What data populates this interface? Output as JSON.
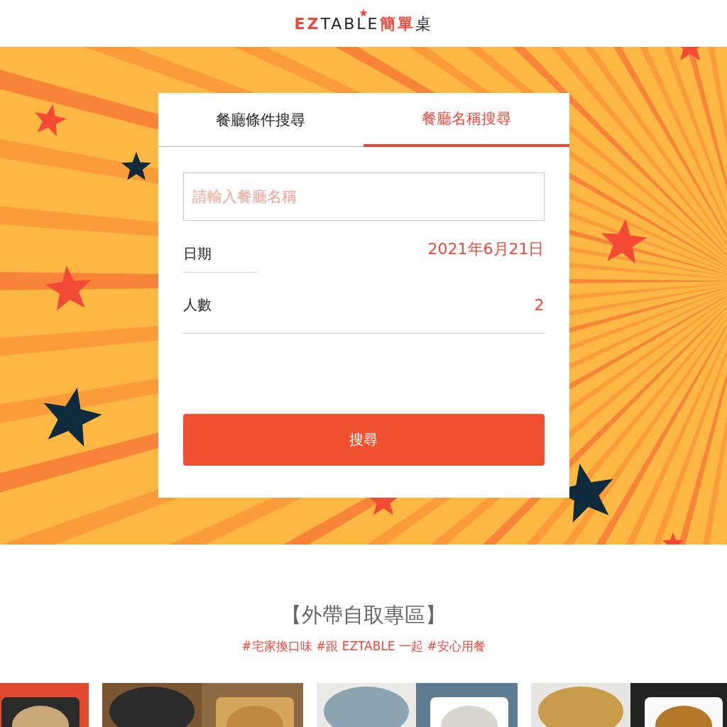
{
  "logo": {
    "parts": [
      {
        "text": "EZ",
        "kind": "accent"
      },
      {
        "text": "TABLE",
        "kind": "plain"
      },
      {
        "text": "簡單",
        "kind": "accent"
      },
      {
        "text": "桌",
        "kind": "plain"
      }
    ]
  },
  "search_card": {
    "tabs": [
      {
        "label": "餐廳條件搜尋",
        "selected": false
      },
      {
        "label": "餐廳名稱搜尋",
        "selected": true
      }
    ],
    "name_field": {
      "placeholder": "請輸入餐廳名稱"
    },
    "fields": [
      {
        "label": "日期",
        "value": "2021年6月21日"
      },
      {
        "label": "人數",
        "value": "2"
      }
    ],
    "search_button": "搜尋"
  },
  "takeout_section": {
    "title": "【外帶自取專區】",
    "hashtags": "#宅家換口味 #跟 EZTABLE 一起 #安心用餐"
  }
}
